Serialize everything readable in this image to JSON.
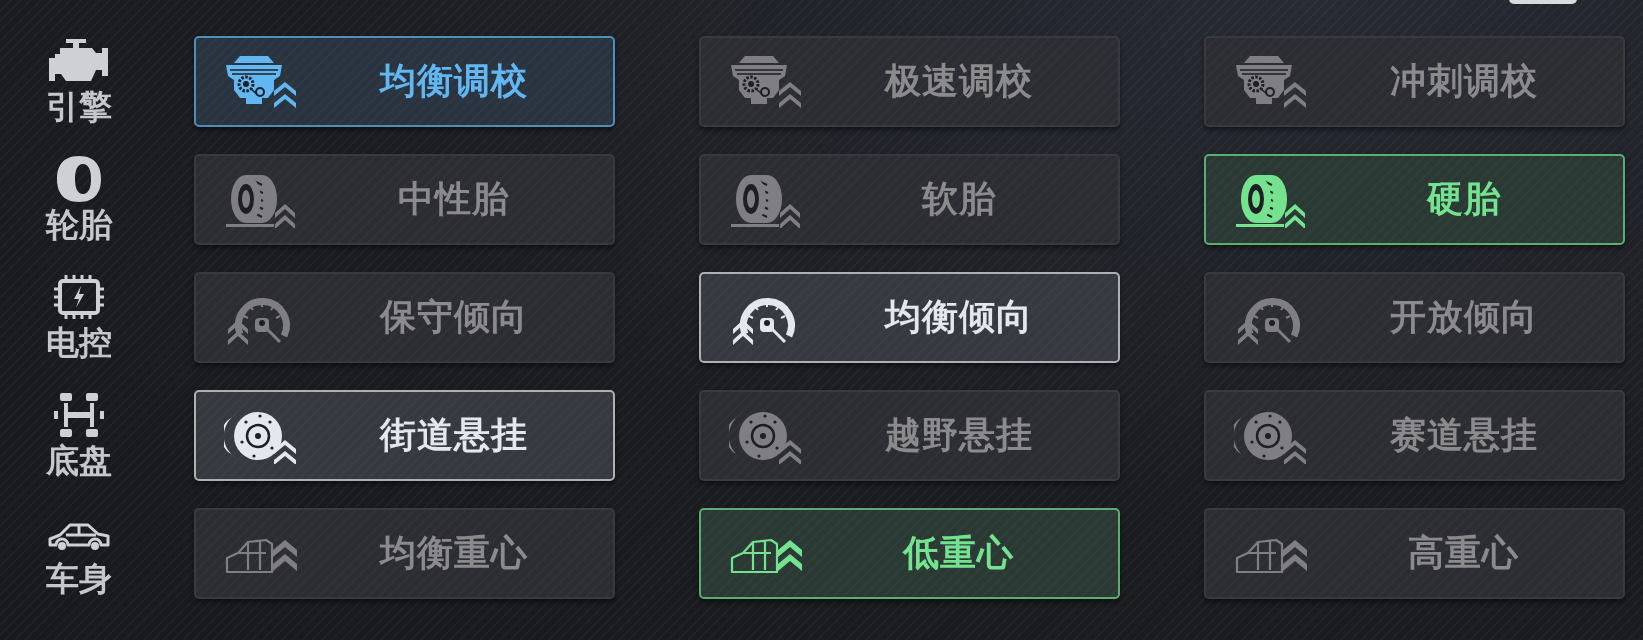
{
  "categories": [
    {
      "kind": "engine",
      "label": "引擎",
      "color": "#62b6f2",
      "options": [
        {
          "label": "均衡调校",
          "selected": true
        },
        {
          "label": "极速调校",
          "selected": false
        },
        {
          "label": "冲刺调校",
          "selected": false
        }
      ]
    },
    {
      "kind": "tire",
      "label": "轮胎",
      "color": "#74e28e",
      "options": [
        {
          "label": "中性胎",
          "selected": false
        },
        {
          "label": "软胎",
          "selected": false
        },
        {
          "label": "硬胎",
          "selected": true
        }
      ]
    },
    {
      "kind": "ecu",
      "label": "电控",
      "color": "#e4e7ee",
      "options": [
        {
          "label": "保守倾向",
          "selected": false
        },
        {
          "label": "均衡倾向",
          "selected": true
        },
        {
          "label": "开放倾向",
          "selected": false
        }
      ]
    },
    {
      "kind": "chassis",
      "label": "底盘",
      "color": "#e4e7ee",
      "options": [
        {
          "label": "街道悬挂",
          "selected": true
        },
        {
          "label": "越野悬挂",
          "selected": false
        },
        {
          "label": "赛道悬挂",
          "selected": false
        }
      ]
    },
    {
      "kind": "body",
      "label": "车身",
      "color": "#74e28e",
      "options": [
        {
          "label": "均衡重心",
          "selected": false
        },
        {
          "label": "低重心",
          "selected": true
        },
        {
          "label": "高重心",
          "selected": false
        }
      ]
    }
  ]
}
